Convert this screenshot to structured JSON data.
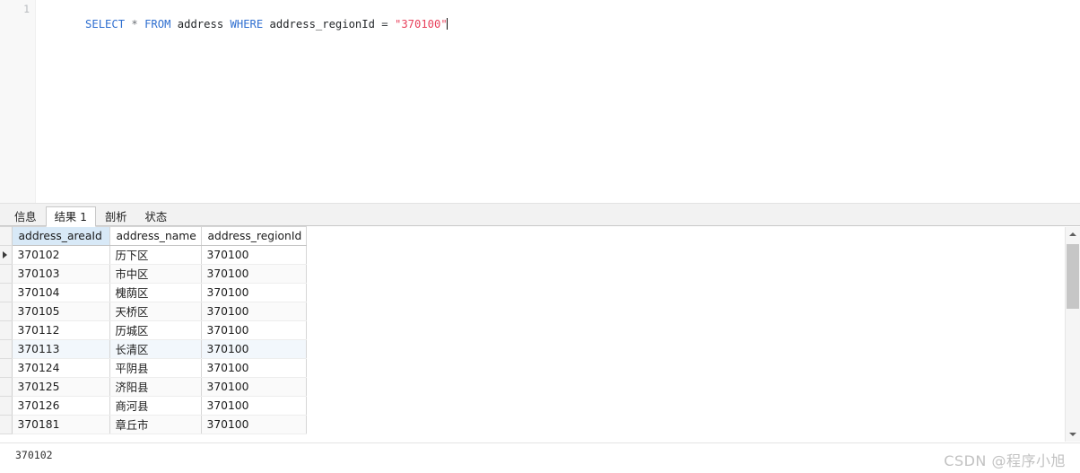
{
  "editor": {
    "line_number": "1",
    "sql_tokens": [
      {
        "text": "SELECT",
        "type": "keyword"
      },
      {
        "text": " ",
        "type": "plain"
      },
      {
        "text": "*",
        "type": "star"
      },
      {
        "text": " ",
        "type": "plain"
      },
      {
        "text": "FROM",
        "type": "keyword"
      },
      {
        "text": " ",
        "type": "plain"
      },
      {
        "text": "address",
        "type": "identifier"
      },
      {
        "text": " ",
        "type": "plain"
      },
      {
        "text": "WHERE",
        "type": "keyword"
      },
      {
        "text": " ",
        "type": "plain"
      },
      {
        "text": "address_regionId",
        "type": "identifier"
      },
      {
        "text": " ",
        "type": "plain"
      },
      {
        "text": "=",
        "type": "operator"
      },
      {
        "text": " ",
        "type": "plain"
      },
      {
        "text": "\"370100\"",
        "type": "string"
      }
    ],
    "sql_plain": "SELECT * FROM address WHERE address_regionId = \"370100\""
  },
  "tabs": [
    {
      "label": "信息",
      "active": false
    },
    {
      "label": "结果 1",
      "active": true
    },
    {
      "label": "剖析",
      "active": false
    },
    {
      "label": "状态",
      "active": false
    }
  ],
  "grid": {
    "columns": [
      {
        "label": "address_areaId",
        "selected": true
      },
      {
        "label": "address_name",
        "selected": false
      },
      {
        "label": "address_regionId",
        "selected": false
      }
    ],
    "rows": [
      {
        "cells": [
          "370102",
          "历下区",
          "370100"
        ],
        "current": true,
        "hilite": false
      },
      {
        "cells": [
          "370103",
          "市中区",
          "370100"
        ],
        "current": false,
        "hilite": false
      },
      {
        "cells": [
          "370104",
          "槐荫区",
          "370100"
        ],
        "current": false,
        "hilite": false
      },
      {
        "cells": [
          "370105",
          "天桥区",
          "370100"
        ],
        "current": false,
        "hilite": false
      },
      {
        "cells": [
          "370112",
          "历城区",
          "370100"
        ],
        "current": false,
        "hilite": false
      },
      {
        "cells": [
          "370113",
          "长清区",
          "370100"
        ],
        "current": false,
        "hilite": true
      },
      {
        "cells": [
          "370124",
          "平阴县",
          "370100"
        ],
        "current": false,
        "hilite": false
      },
      {
        "cells": [
          "370125",
          "济阳县",
          "370100"
        ],
        "current": false,
        "hilite": false
      },
      {
        "cells": [
          "370126",
          "商河县",
          "370100"
        ],
        "current": false,
        "hilite": false
      },
      {
        "cells": [
          "370181",
          "章丘市",
          "370100"
        ],
        "current": false,
        "hilite": false
      }
    ]
  },
  "scrollbar": {
    "up_icon": "chevron-up-icon",
    "down_icon": "chevron-down-icon"
  },
  "status": {
    "value": "370102",
    "watermark": "CSDN @程序小旭"
  },
  "colors": {
    "keyword": "#2f6fd0",
    "string": "#e8415c",
    "selected_column_header": "#d8e9f7",
    "grid_border": "#d6d6d6",
    "watermark": "#c2c2c2"
  }
}
